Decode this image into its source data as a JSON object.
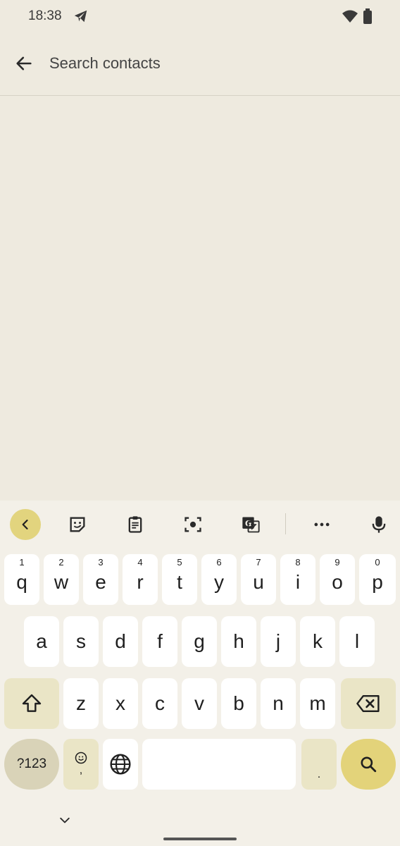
{
  "status_bar": {
    "time": "18:38"
  },
  "search": {
    "placeholder": "Search contacts"
  },
  "keyboard": {
    "row1": [
      {
        "label": "q",
        "hint": "1"
      },
      {
        "label": "w",
        "hint": "2"
      },
      {
        "label": "e",
        "hint": "3"
      },
      {
        "label": "r",
        "hint": "4"
      },
      {
        "label": "t",
        "hint": "5"
      },
      {
        "label": "y",
        "hint": "6"
      },
      {
        "label": "u",
        "hint": "7"
      },
      {
        "label": "i",
        "hint": "8"
      },
      {
        "label": "o",
        "hint": "9"
      },
      {
        "label": "p",
        "hint": "0"
      }
    ],
    "row2": [
      "a",
      "s",
      "d",
      "f",
      "g",
      "h",
      "j",
      "k",
      "l"
    ],
    "row3": [
      "z",
      "x",
      "c",
      "v",
      "b",
      "n",
      "m"
    ],
    "symbols_label": "?123",
    "emoji_comma_label": ",",
    "period_label": "."
  },
  "colors": {
    "background": "#EEEADF",
    "accent": "#E3D37A",
    "modifier": "#EAE5C6"
  }
}
